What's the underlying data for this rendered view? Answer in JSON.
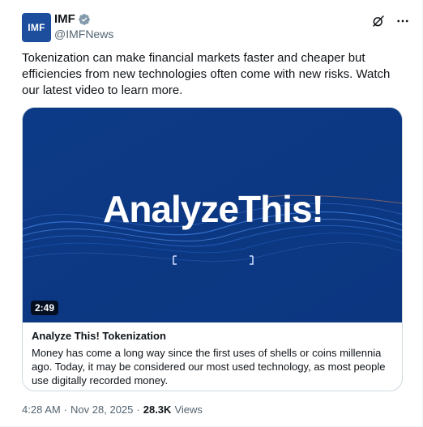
{
  "author": {
    "avatar_text": "IMF",
    "name": "IMF",
    "handle": "@IMFNews"
  },
  "tweet": {
    "text": "Tokenization can make financial markets faster and cheaper but efficiencies from new technologies often come with new risks. Watch our latest video to learn more."
  },
  "card": {
    "video_title": "AnalyzeThis!",
    "duration": "2:49",
    "title": "Analyze This! Tokenization",
    "description": "Money has come a long way since the first uses of shells or coins millennia ago. Today, it may be considered our most used technology, as most people use digitally recorded money."
  },
  "meta": {
    "time": "4:28 AM",
    "separator": "·",
    "date": "Nov 28, 2025",
    "separator2": "·",
    "views_count": "28.3K",
    "views_label": "Views"
  },
  "colors": {
    "video_bg": "#0f3f8f",
    "avatar_bg": "#1d4e9e",
    "verified": "#829aab"
  },
  "icons": [
    "verified-badge-icon",
    "grok-icon",
    "more-icon"
  ]
}
